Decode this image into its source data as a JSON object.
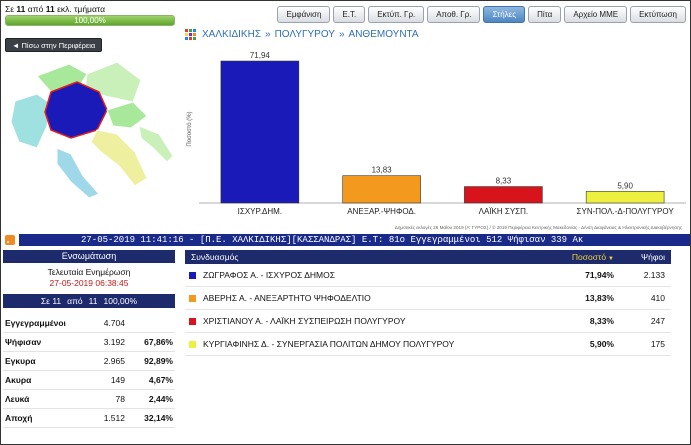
{
  "header": {
    "counter_prefix": "Σε",
    "counter_done": "11",
    "counter_mid": "από",
    "counter_total": "11",
    "counter_suffix": "εκλ. τμήματα",
    "progress_label": "100,00%",
    "progress_value": 100
  },
  "toolbar": {
    "buttons": [
      {
        "label": "Εμφάνιση",
        "active": false
      },
      {
        "label": "Ε.Τ.",
        "active": false
      },
      {
        "label": "Εκτύπ. Γρ.",
        "active": false
      },
      {
        "label": "Αποθ. Γρ.",
        "active": false
      },
      {
        "label": "Στήλες",
        "active": true
      },
      {
        "label": "Πίτα",
        "active": false
      },
      {
        "label": "Αρχείο ΜΜΕ",
        "active": false
      },
      {
        "label": "Εκτύπωση",
        "active": false
      }
    ]
  },
  "back_button": "◄ Πίσω στην Περιφέρεια",
  "breadcrumb": {
    "items": [
      "ΧΑΛΚΙΔΙΚΗΣ",
      "ΠΟΛΥΓΥΡΟΥ",
      "ΑΝΘΕΜΟΥΝΤΑ"
    ],
    "separator": "»"
  },
  "chart_data": {
    "type": "bar",
    "categories": [
      "ΙΣΧΥΡ.ΔΗΜ.",
      "ΑΝΕΞΑΡ.-ΨΗΦΟΔ.",
      "ΛΑΪΚΗ ΣΥΣΠ.",
      "ΣΥΝ-ΠΟΛ.-Δ-ΠΟΛΥΓΥΡΟΥ"
    ],
    "values": [
      71.94,
      13.83,
      8.33,
      5.9
    ],
    "value_labels": [
      "71,94",
      "13,83",
      "8,33",
      "5,90"
    ],
    "colors": [
      "#1a1ab8",
      "#f39a1e",
      "#d7131b",
      "#eef040"
    ],
    "ylabel": "Ποσοστό (%)",
    "ylim": [
      0,
      75
    ],
    "grid": false,
    "footer": "Δημοτικές εκλογές 26 Μαΐου 2019 (Α' ΓΥΡΟΣ) / © 2019 Περιφέρεια Κεντρικής Μακεδονίας - Δ/νση Διαφάνειας & Ηλεκτρονικής Διακυβέρνησης"
  },
  "ticker": {
    "text": "27-05-2019 11:41:16 - [Π.Ε. ΧΑΛΚΙΔΙΚΗΣ][ΚΑΣΣΑΝΔΡΑΣ] Ε.Τ: 81ο Εγγεγραμμένοι 512 Ψήφισαν 339 Ακ"
  },
  "summary": {
    "title": "Ενσωμάτωση",
    "update_title": "Τελευταία Ενημέρωση",
    "update_time": "27-05-2019 06:38:45",
    "band": {
      "prefix": "Σε 11",
      "mid": "από",
      "total": "11",
      "pct": "100,00%"
    },
    "rows": [
      {
        "label": "Εγγεγραμμένοι",
        "value": "4.704",
        "pct": ""
      },
      {
        "label": "Ψήφισαν",
        "value": "3.192",
        "pct": "67,86%"
      },
      {
        "label": "Εγκυρα",
        "value": "2.965",
        "pct": "92,89%"
      },
      {
        "label": "Ακυρα",
        "value": "149",
        "pct": "4,67%"
      },
      {
        "label": "Λευκά",
        "value": "78",
        "pct": "2,44%"
      },
      {
        "label": "Αποχή",
        "value": "1.512",
        "pct": "32,14%"
      }
    ]
  },
  "results": {
    "headers": {
      "combo": "Συνδυασμός",
      "pct": "Ποσοστό",
      "votes": "Ψήφοι"
    },
    "rows": [
      {
        "color": "#1a1ab8",
        "name": "ΖΩΓΡΑΦΟΣ Α. - ΙΣΧΥΡΟΣ ΔΗΜΟΣ",
        "pct": "71,94%",
        "votes": "2.133"
      },
      {
        "color": "#f39a1e",
        "name": "ΑΒΕΡΗΣ Α. - ΑΝΕΞΑΡΤΗΤΟ ΨΗΦΟΔΕΛΤΙΟ",
        "pct": "13,83%",
        "votes": "410"
      },
      {
        "color": "#d7131b",
        "name": "ΧΡΙΣΤΙΑΝΟΥ Α. - ΛΑΪΚΗ ΣΥΣΠΕΙΡΩΣΗ ΠΟΛΥΓΥΡΟΥ",
        "pct": "8,33%",
        "votes": "247"
      },
      {
        "color": "#eef040",
        "name": "ΚΥΡΓΙΑΦΙΝΗΣ Δ. - ΣΥΝΕΡΓΑΣΙΑ ΠΟΛΙΤΩΝ ΔΗΜΟΥ ΠΟΛΥΓΥΡΟΥ",
        "pct": "5,90%",
        "votes": "175"
      }
    ]
  }
}
